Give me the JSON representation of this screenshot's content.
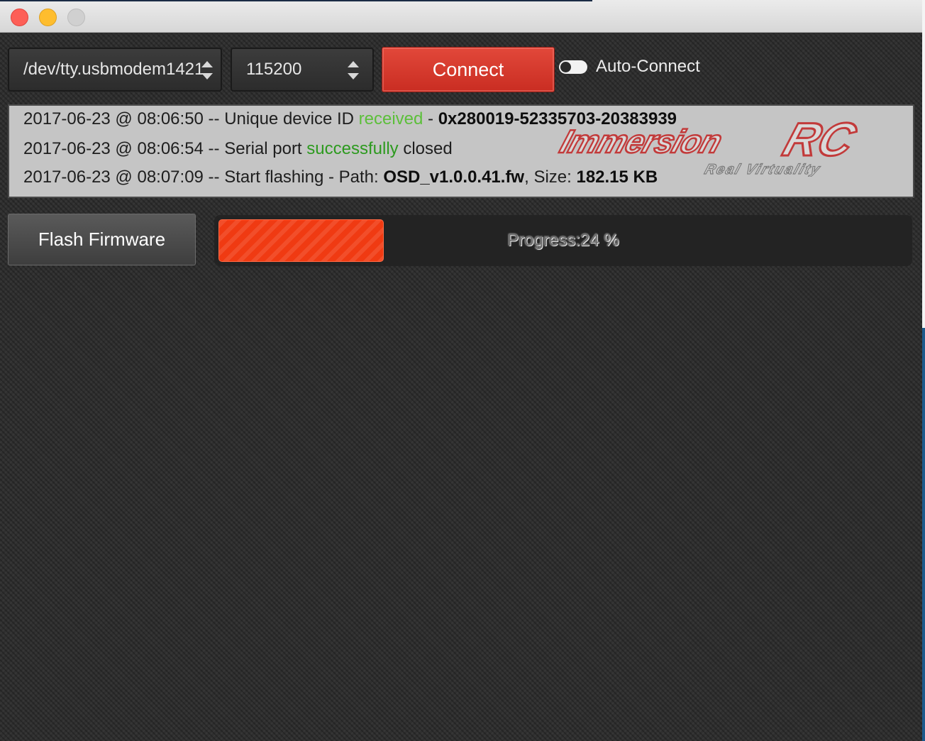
{
  "port_select": {
    "value": "/dev/tty.usbmodem1421"
  },
  "baud_select": {
    "value": "115200"
  },
  "connect_button": {
    "label": "Connect",
    "color": "#d63a2e"
  },
  "auto_connect": {
    "label": "Auto-Connect",
    "enabled": false
  },
  "log": {
    "watermark": {
      "brand": "ImmersionRC",
      "tagline": "Real Virtuality"
    },
    "lines": [
      {
        "timestamp": "2017-06-23 @ 08:06:50 -- ",
        "text1": "Unique device ID ",
        "status": "received",
        "text2": " - ",
        "value": "0x280019-52335703-20383939"
      },
      {
        "timestamp": "2017-06-23 @ 08:06:54 -- ",
        "text1": "Serial port ",
        "status": "successfully",
        "text2": " closed"
      },
      {
        "timestamp": "2017-06-23 @ 08:07:09 -- ",
        "text1": "Start flashing - Path: ",
        "path": "OSD_v1.0.0.41.fw",
        "text2": ", Size: ",
        "size": "182.15 KB"
      }
    ]
  },
  "flash_button": {
    "label": "Flash Firmware"
  },
  "progress": {
    "label": "Progress:24 %",
    "fraction": 0.24,
    "color": "#f03a12"
  },
  "status_colors": {
    "received": "#5cbf3a",
    "successfully": "#2d9a1f"
  }
}
